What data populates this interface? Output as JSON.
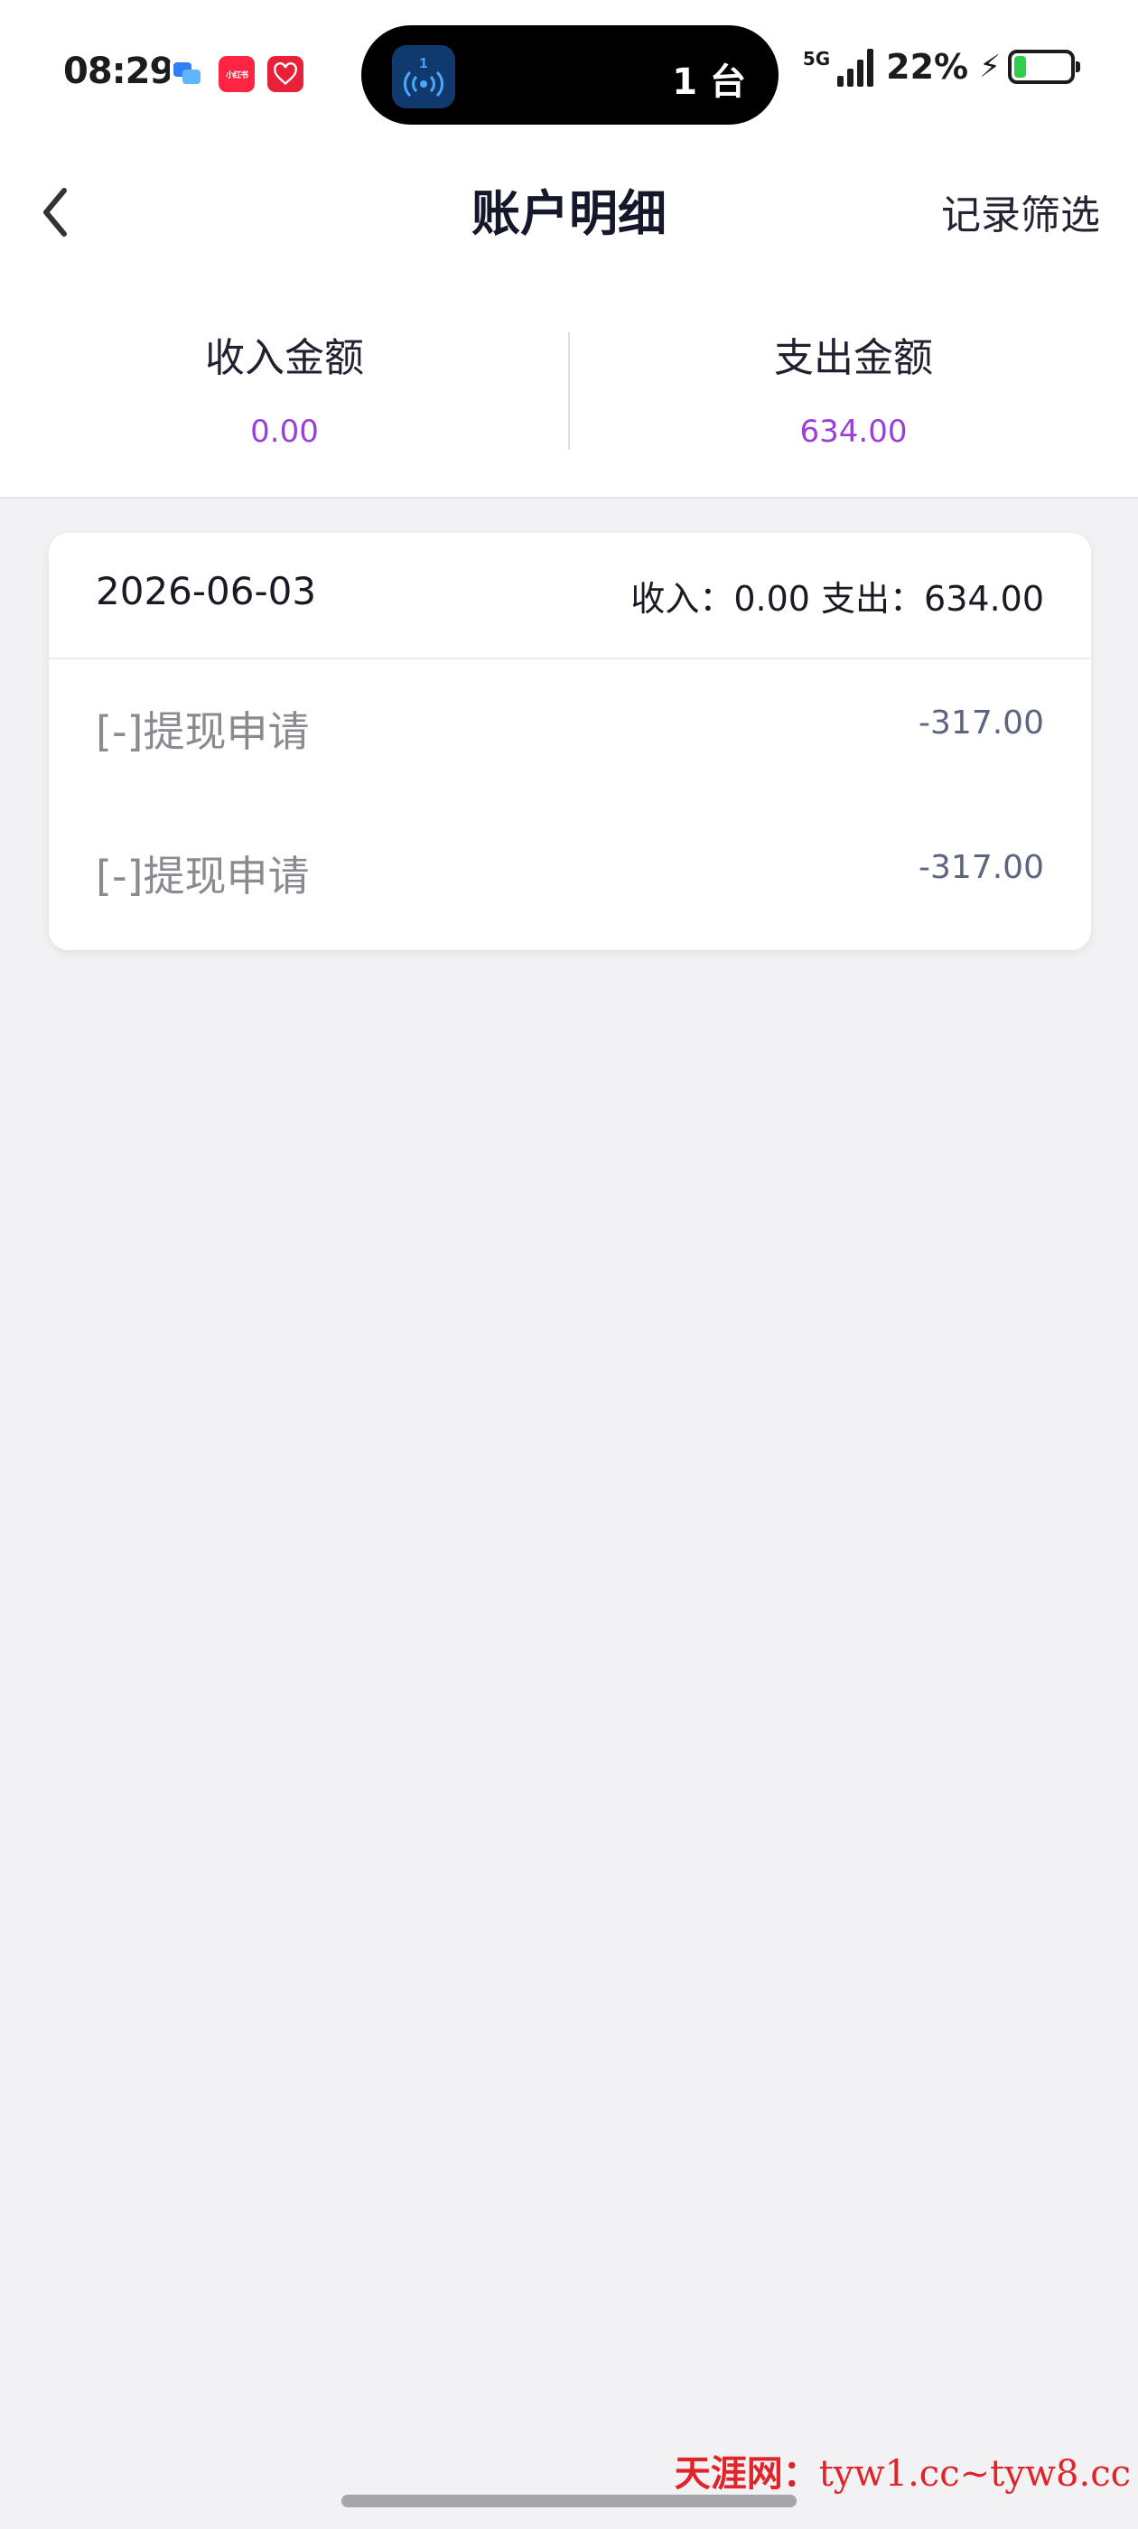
{
  "status_bar": {
    "time": "08:29",
    "notifications": [
      {
        "icon": "chat-bubble-icon",
        "label": ""
      },
      {
        "icon": "xiaohongshu-icon",
        "label": "小红书"
      },
      {
        "icon": "app-heart-icon",
        "label": ""
      }
    ],
    "island": {
      "app_icon": "broadcast-icon",
      "badge": "1",
      "text": "1 台"
    },
    "network": "5G",
    "battery_percent": "22%",
    "battery_level": 0.22,
    "charging": true,
    "colors": {
      "battery_fill": "#2fce4c"
    }
  },
  "nav": {
    "back_icon": "chevron-left-icon",
    "title": "账户明细",
    "filter_label": "记录筛选"
  },
  "summary": {
    "income_label": "收入金额",
    "income_value": "0.00",
    "expense_label": "支出金额",
    "expense_value": "634.00",
    "value_color": "#9b3fd9"
  },
  "day_groups": [
    {
      "date": "2026-06-03",
      "totals": "收入：0.00 支出：634.00",
      "records": [
        {
          "title": "[-]提现申请",
          "amount": "-317.00"
        },
        {
          "title": "[-]提现申请",
          "amount": "-317.00"
        }
      ]
    }
  ],
  "watermark": {
    "brand": "天涯网：",
    "text": "tyw1.cc~tyw8.cc"
  }
}
